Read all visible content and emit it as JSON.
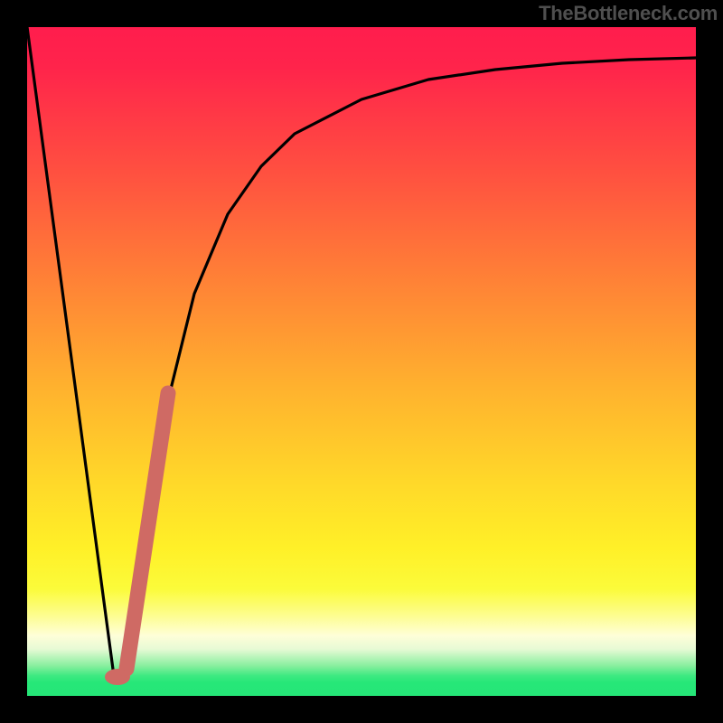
{
  "watermark": "TheBottleneck.com",
  "chart_data": {
    "type": "line",
    "title": "",
    "xlabel": "",
    "ylabel": "",
    "xlim": [
      0,
      100
    ],
    "ylim": [
      0,
      100
    ],
    "series": [
      {
        "name": "curve",
        "x": [
          0,
          13,
          15,
          17,
          20,
          25,
          30,
          35,
          40,
          50,
          60,
          70,
          80,
          90,
          100
        ],
        "values": [
          100,
          3,
          5,
          20,
          40,
          60,
          72,
          79,
          84,
          89,
          92,
          93.5,
          94.5,
          95,
          95.3
        ]
      }
    ],
    "highlight_segment": {
      "x0": 15,
      "y0": 5,
      "x1": 21,
      "y1": 45
    },
    "optimal_point": {
      "x": 13,
      "y": 3
    },
    "gradient_stops": [
      {
        "pos": 0,
        "color": "#ff1d4d"
      },
      {
        "pos": 0.5,
        "color": "#ffb22e"
      },
      {
        "pos": 0.8,
        "color": "#fff028"
      },
      {
        "pos": 0.97,
        "color": "#3de981"
      },
      {
        "pos": 1.0,
        "color": "#25e677"
      }
    ]
  }
}
